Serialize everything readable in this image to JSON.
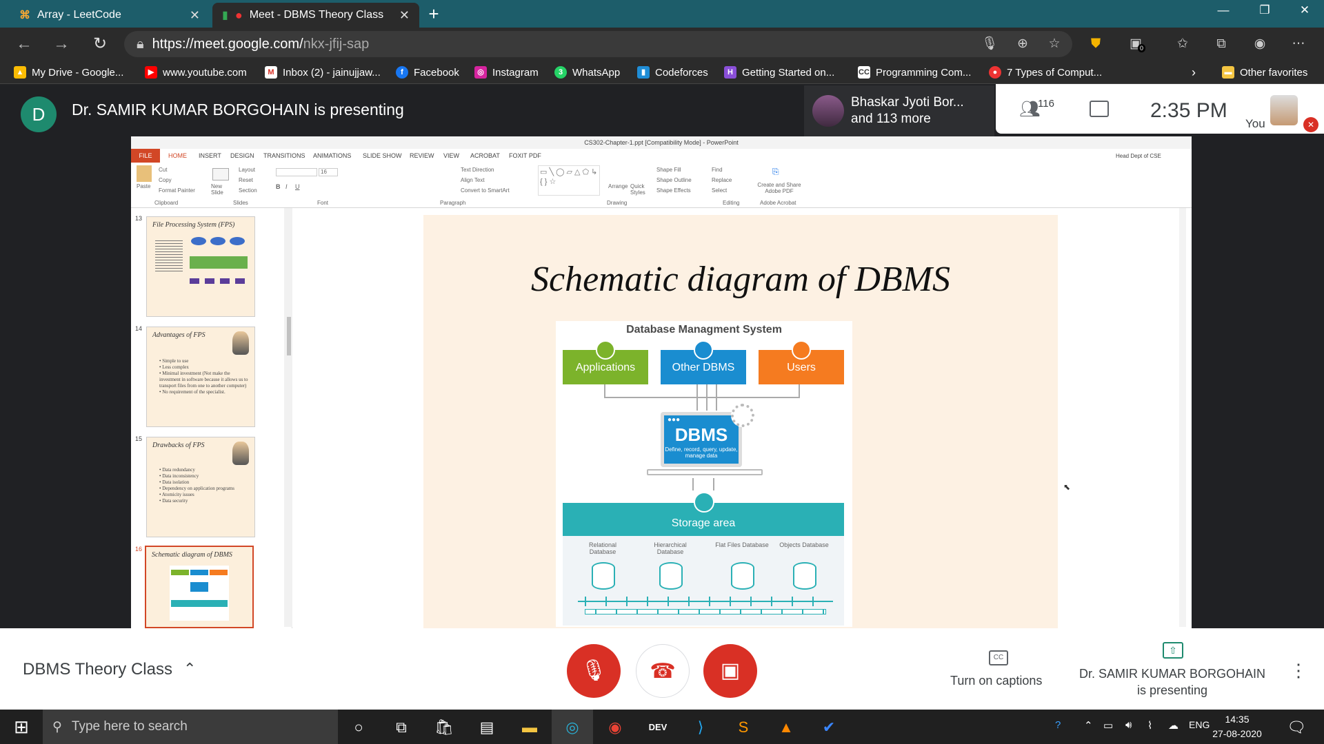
{
  "browser": {
    "tabs": [
      {
        "title": "Array - LeetCode"
      },
      {
        "title": "Meet - DBMS Theory Class"
      }
    ],
    "url": {
      "host": "https://meet.google.com/",
      "path": "nkx-jfij-sap"
    },
    "extension_badge": "0",
    "bookmarks": [
      "My Drive - Google...",
      "www.youtube.com",
      "Inbox (2) - jainujjaw...",
      "Facebook",
      "Instagram",
      "WhatsApp",
      "Codeforces",
      "Getting Started on...",
      "Programming Com...",
      "7 Types of Comput..."
    ],
    "other_favorites": "Other favorites"
  },
  "meet": {
    "presenter_initial": "D",
    "presenting_text": "Dr. SAMIR KUMAR BORGOHAIN is presenting",
    "participant_name": "Bhaskar Jyoti Bor...",
    "participant_more": "and 113 more",
    "people_count": "116",
    "time": "2:35 PM",
    "you_label": "You",
    "class_name": "DBMS Theory Class",
    "captions_label": "Turn on captions",
    "presenter_status": "Dr. SAMIR KUMAR BORGOHAIN is presenting"
  },
  "powerpoint": {
    "window_title": "CS302-Chapter-1.ppt [Compatibility Mode] - PowerPoint",
    "user": "Head Dept of CSE",
    "file_tab": "FILE",
    "tabs": [
      "HOME",
      "INSERT",
      "DESIGN",
      "TRANSITIONS",
      "ANIMATIONS",
      "SLIDE SHOW",
      "REVIEW",
      "VIEW",
      "ACROBAT",
      "FOXIT PDF"
    ],
    "ribbon_groups": [
      "Clipboard",
      "Slides",
      "Font",
      "Paragraph",
      "Drawing",
      "Editing",
      "Adobe Acrobat"
    ],
    "ribbon_items": {
      "paste": "Paste",
      "cut": "Cut",
      "copy": "Copy",
      "format_painter": "Format Painter",
      "new_slide": "New Slide",
      "layout": "Layout",
      "reset": "Reset",
      "section": "Section",
      "font_size": "16",
      "text_direction": "Text Direction",
      "align_text": "Align Text",
      "convert_smartart": "Convert to SmartArt",
      "arrange": "Arrange",
      "quick_styles": "Quick Styles",
      "shape_fill": "Shape Fill",
      "shape_outline": "Shape Outline",
      "shape_effects": "Shape Effects",
      "find": "Find",
      "replace": "Replace",
      "select": "Select",
      "create_share": "Create and Share Adobe PDF"
    },
    "thumbnails": [
      {
        "num": "13",
        "title": "File Processing System (FPS)",
        "bullets": []
      },
      {
        "num": "14",
        "title": "Advantages of FPS",
        "bullets": [
          "Simple to use",
          "Less complex",
          "Minimal investment (Not make the investment in software because it allows us to transport files from one to another computer)",
          "No requirement of the specialist."
        ]
      },
      {
        "num": "15",
        "title": "Drawbacks of FPS",
        "bullets": [
          "Data redundancy",
          "Data inconsistency",
          "Data isolation",
          "Dependency on application programs",
          "Atomicity issues",
          "Data security"
        ]
      },
      {
        "num": "16",
        "title": "Schematic diagram of DBMS",
        "bullets": []
      }
    ],
    "slide": {
      "title": "Schematic diagram of DBMS",
      "diagram_title": "Database Managment System",
      "boxes": [
        {
          "label": "Applications",
          "color": "#7cb32b"
        },
        {
          "label": "Other DBMS",
          "color": "#1a8dd0"
        },
        {
          "label": "Users",
          "color": "#f57b20"
        }
      ],
      "dbms_label": "DBMS",
      "dbms_sub": "Define, record, query, update, manage data",
      "storage_label": "Storage area",
      "databases": [
        "Relational Database",
        "Hierarchical Database",
        "Flat Files Database",
        "Objects Database"
      ]
    }
  },
  "taskbar": {
    "search_placeholder": "Type here to search",
    "language": "ENG",
    "time": "14:35",
    "date": "27-08-2020"
  }
}
